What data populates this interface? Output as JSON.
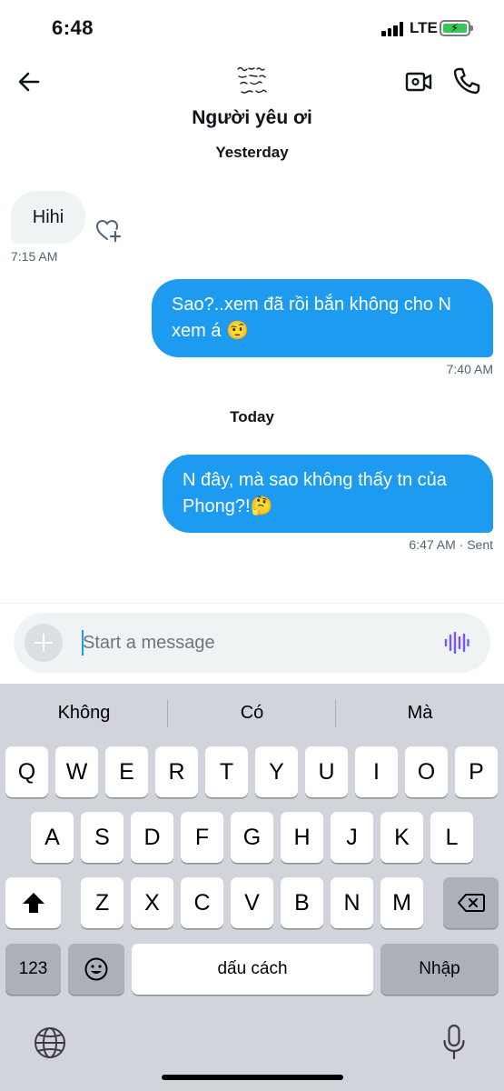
{
  "status_bar": {
    "time": "6:48",
    "network": "LTE"
  },
  "header": {
    "contact_name": "Người yêu ơi"
  },
  "messages": {
    "day_yesterday": "Yesterday",
    "incoming_1": {
      "text": "Hihi",
      "time": "7:15 AM"
    },
    "outgoing_1": {
      "text": "Sao?..xem đã rồi bắn không cho N xem á 🤨",
      "time": "7:40 AM"
    },
    "day_today": "Today",
    "outgoing_2": {
      "text": "N đây, mà sao không thấy tn của Phong?!🤔",
      "time": "6:47 AM · Sent"
    }
  },
  "composer": {
    "placeholder": "Start a message"
  },
  "keyboard": {
    "suggestions": [
      "Không",
      "Có",
      "Mà"
    ],
    "row1": [
      "Q",
      "W",
      "E",
      "R",
      "T",
      "Y",
      "U",
      "I",
      "O",
      "P"
    ],
    "row2": [
      "A",
      "S",
      "D",
      "F",
      "G",
      "H",
      "J",
      "K",
      "L"
    ],
    "row3": [
      "Z",
      "X",
      "C",
      "V",
      "B",
      "N",
      "M"
    ],
    "numbers_label": "123",
    "space_label": "dấu cách",
    "return_label": "Nhập"
  },
  "colors": {
    "accent": "#1d9bf0",
    "bubble_in": "#eff3f4",
    "voice": "#7856ff"
  },
  "icons": [
    "back-arrow-icon",
    "video-call-icon",
    "phone-icon",
    "heart-plus-icon",
    "plus-icon",
    "voice-wave-icon",
    "shift-icon",
    "backspace-icon",
    "emoji-icon",
    "globe-icon",
    "microphone-icon"
  ]
}
